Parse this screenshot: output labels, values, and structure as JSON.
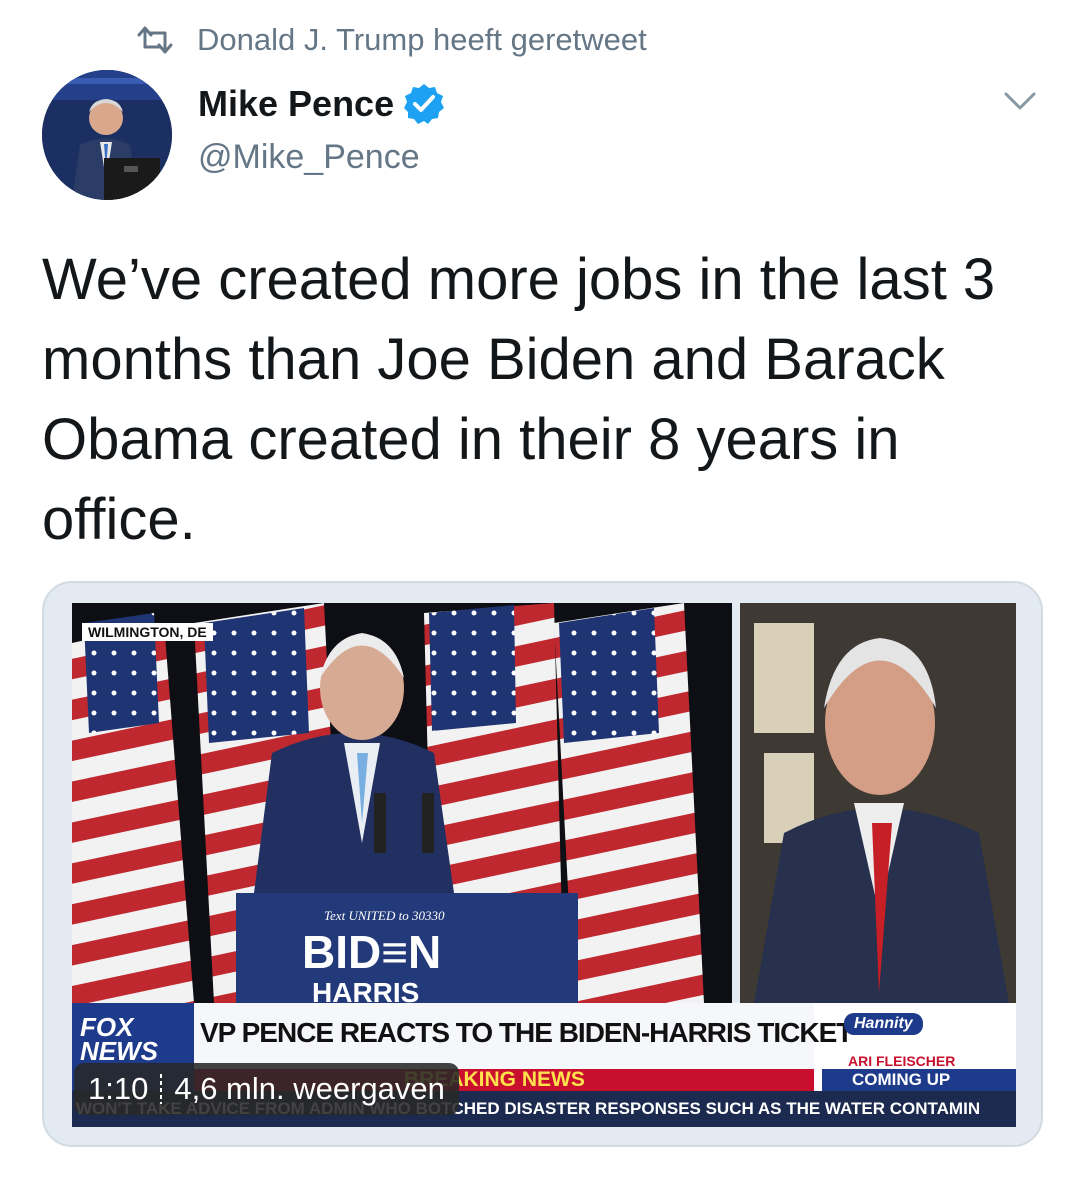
{
  "retweet": {
    "icon": "retweet-icon",
    "label": "Donald J. Trump heeft geretweet"
  },
  "author": {
    "name": "Mike Pence",
    "handle": "@Mike_Pence",
    "verified_icon": "verified-badge-icon",
    "avatar_icon": "avatar"
  },
  "menu_icon": "chevron-down-icon",
  "tweet": {
    "text": "We’ve created more jobs in the last 3 months than Joe Biden and Barack Obama created in their 8 years in office."
  },
  "media": {
    "location_tag": "WILMINGTON, DE",
    "podium_text_line": "Text UNITED to 30330",
    "podium_logo_line1": "BID≡N",
    "podium_logo_line2": "HARRIS",
    "network_logo": "FOX NEWS",
    "headline": "VP PENCE REACTS TO THE BIDEN-HARRIS TICKET",
    "show_logo": "Hannity",
    "guest_name": "ARI FLEISCHER",
    "coming_up": "COMING UP",
    "breaking": "BREAKING NEWS",
    "ticker": "WON'T TAKE ADVICE FROM ADMIN WHO BOTCHED DISASTER RESPONSES SUCH AS THE WATER CONTAMIN",
    "duration": "1:10",
    "views": "4,6 mln. weergaven"
  },
  "colors": {
    "accent": "#1da1f2",
    "secondary_text": "#657786",
    "fox_red": "#c8102e",
    "fox_blue": "#1e3a8a"
  }
}
